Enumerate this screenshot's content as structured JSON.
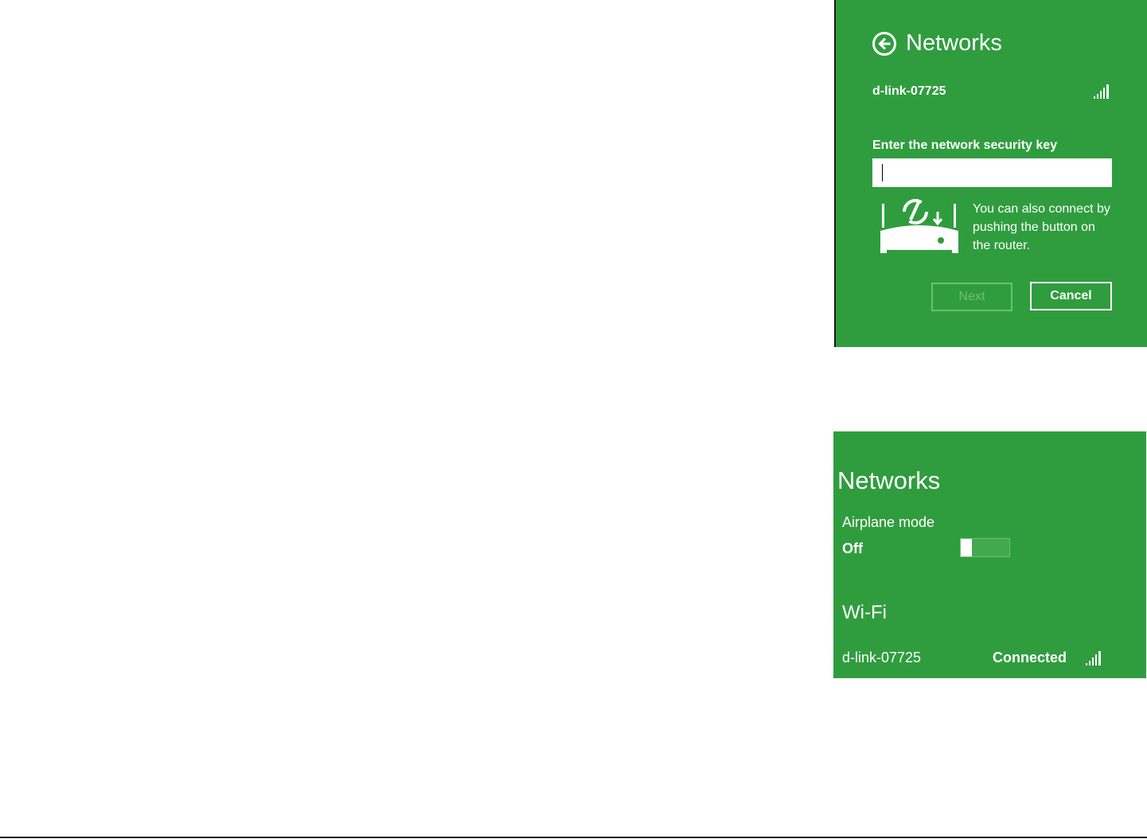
{
  "colors": {
    "panel_bg": "#2f9d3e",
    "text": "#ffffff",
    "disabled": "#6cbf78"
  },
  "top_panel": {
    "back_icon": "back-arrow-circle-icon",
    "title": "Networks",
    "network_name": "d-link-07725",
    "signal_icon": "signal-strength-icon",
    "key_label": "Enter the network security key",
    "key_value": "",
    "router_icon": "wps-router-icon",
    "wps_message": "You can also connect by pushing the button on the router.",
    "next_label": "Next",
    "cancel_label": "Cancel"
  },
  "bottom_panel": {
    "title": "Networks",
    "airplane_mode_label": "Airplane mode",
    "airplane_mode_state": "Off",
    "airplane_mode_on": false,
    "wifi_heading": "Wi-Fi",
    "network_name": "d-link-07725",
    "network_status": "Connected",
    "signal_icon": "signal-strength-icon"
  }
}
